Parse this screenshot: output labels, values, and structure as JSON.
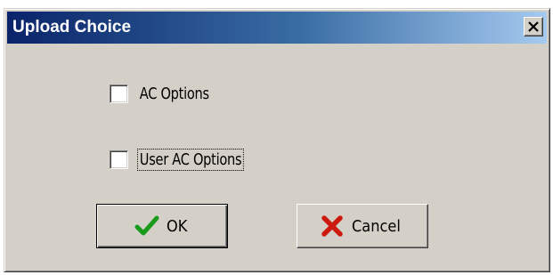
{
  "dialog": {
    "title": "Upload Choice",
    "close_icon": "close-x-icon"
  },
  "options": [
    {
      "label": "AC Options",
      "checked": false,
      "focused": false
    },
    {
      "label": "User AC Options",
      "checked": false,
      "focused": true
    }
  ],
  "buttons": {
    "ok": {
      "label": "OK",
      "icon": "checkmark-icon",
      "icon_color": "#1a9a1a",
      "default": true
    },
    "cancel": {
      "label": "Cancel",
      "icon": "red-x-icon",
      "icon_color": "#cc1a10"
    }
  },
  "colors": {
    "face": "#d4d0c8",
    "title_start": "#0a246a",
    "title_end": "#a6caf0"
  }
}
